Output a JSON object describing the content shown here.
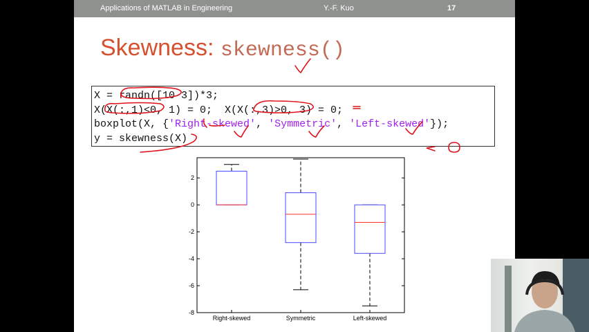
{
  "header": {
    "course": "Applications of MATLAB in Engineering",
    "author": "Y.-F. Kuo",
    "page": "17"
  },
  "title": {
    "word": "Skewness: ",
    "func": "skewness()"
  },
  "code": {
    "line1": "X = randn([10 3])*3;",
    "line2": "X(X(:,1)<0, 1) = 0;  X(X(:,3)>0, 3) = 0;",
    "line3_a": "boxplot(X, {",
    "line3_s1": "'Right-skewed'",
    "line3_sep1": ", ",
    "line3_s2": "'Symmetric'",
    "line3_sep2": ", ",
    "line3_s3": "'Left-skewed'",
    "line3_b": "});",
    "line4": "y = skewness(X)"
  },
  "annotation": "< 0",
  "chart_data": {
    "type": "box",
    "categories": [
      "Right-skewed",
      "Symmetric",
      "Left-skewed"
    ],
    "ylim": [
      -8,
      3.5
    ],
    "yticks": [
      "2",
      "0",
      "-2",
      "-4",
      "-6",
      "-8"
    ],
    "boxes": [
      {
        "whisker_low": 0.0,
        "q1": 0.0,
        "median": 0.0,
        "q3": 2.5,
        "whisker_high": 3.0
      },
      {
        "whisker_low": -6.3,
        "q1": -2.8,
        "median": -0.7,
        "q3": 0.9,
        "whisker_high": 3.4
      },
      {
        "whisker_low": -7.5,
        "q1": -3.6,
        "median": -1.3,
        "q3": 0.0,
        "whisker_high": 0.0
      }
    ],
    "colors": {
      "box": "#4848ff",
      "median": "#ff3030",
      "whisker": "#000000"
    }
  }
}
